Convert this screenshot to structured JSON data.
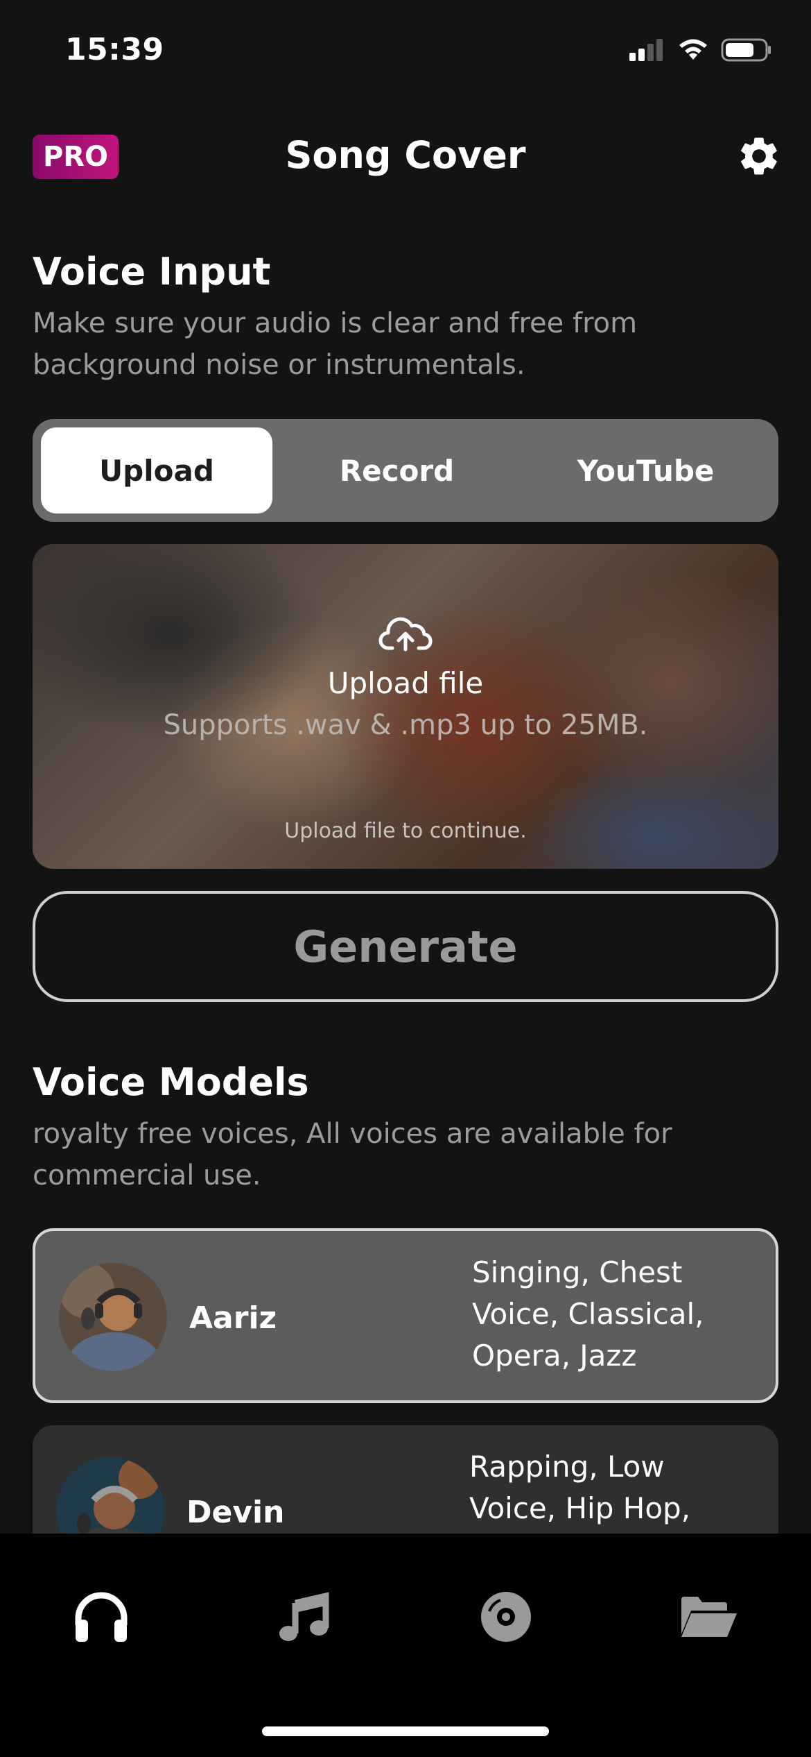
{
  "status_bar": {
    "time": "15:39"
  },
  "header": {
    "pro_label": "PRO",
    "title": "Song Cover"
  },
  "voice_input": {
    "title": "Voice Input",
    "subtitle": "Make sure your audio is clear and free from background noise or instrumentals.",
    "tabs": [
      {
        "label": "Upload",
        "active": true
      },
      {
        "label": "Record",
        "active": false
      },
      {
        "label": "YouTube",
        "active": false
      }
    ],
    "upload": {
      "title": "Upload file",
      "subtitle": "Supports .wav & .mp3 up to 25MB.",
      "hint": "Upload file to continue."
    },
    "generate_label": "Generate"
  },
  "voice_models": {
    "title": "Voice Models",
    "subtitle": "royalty free voices, All voices are available for commercial use.",
    "items": [
      {
        "name": "Aariz",
        "tags": "Singing, Chest Voice, Classical, Opera, Jazz",
        "selected": true
      },
      {
        "name": "Devin",
        "tags": "Rapping, Low Voice, Hip Hop,",
        "selected": false
      }
    ]
  },
  "tab_bar": {
    "items": [
      {
        "icon": "headphones-icon",
        "active": true
      },
      {
        "icon": "music-note-icon",
        "active": false
      },
      {
        "icon": "disc-icon",
        "active": false
      },
      {
        "icon": "folder-open-icon",
        "active": false
      }
    ]
  },
  "colors": {
    "accent_pro": "#c2157d",
    "background": "#131313",
    "segment_bg": "#6b6b6b"
  }
}
